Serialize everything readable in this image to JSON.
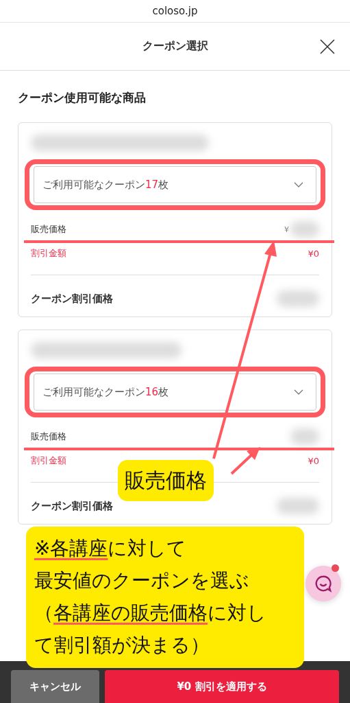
{
  "browser": {
    "url": "coloso.jp"
  },
  "header": {
    "title": "クーポン選択"
  },
  "section_title": "クーポン使用可能な商品",
  "products": [
    {
      "coupon_select": [
        {
          "text": "ご利用可能なクーポン",
          "accent": false
        },
        {
          "text": "17",
          "accent": true
        },
        {
          "text": "枚",
          "accent": false
        }
      ],
      "sale_price_label": "販売価格",
      "sale_price_currency": "¥",
      "discount_label": "割引金額",
      "discount_value": "¥0",
      "coupon_price_label": "クーポン割引価格"
    },
    {
      "coupon_select": [
        {
          "text": "ご利用可能なクーポン",
          "accent": false
        },
        {
          "text": "16",
          "accent": true
        },
        {
          "text": "枚",
          "accent": false
        }
      ],
      "sale_price_label": "販売価格",
      "discount_label": "割引金額",
      "discount_value": "¥0",
      "coupon_price_label": "クーポン割引価格"
    }
  ],
  "chat": {
    "unread": true
  },
  "buttons": {
    "cancel": "キャンセル",
    "apply": "¥0 割引を適用する"
  },
  "annotations": [
    {
      "kind": "label",
      "lines": [
        [
          {
            "text": "販売価格",
            "underlined": false
          }
        ]
      ]
    },
    {
      "kind": "note",
      "lines": [
        [
          {
            "text": "※各講座",
            "underlined": true
          },
          {
            "text": "に対して",
            "underlined": false
          }
        ],
        [
          {
            "text": "最安値のクーポンを選ぶ",
            "underlined": false
          }
        ],
        [
          {
            "text": "（",
            "underlined": false
          },
          {
            "text": "各講座の販売価格",
            "underlined": true
          },
          {
            "text": "に対し",
            "underlined": false
          }
        ],
        [
          {
            "text": "て割引額が決まる）",
            "underlined": false
          }
        ]
      ]
    }
  ]
}
